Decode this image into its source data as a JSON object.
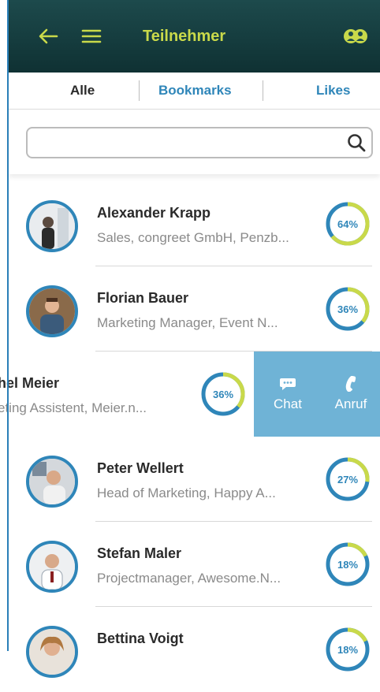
{
  "header": {
    "title": "Teilnehmer",
    "back_icon": "arrow-left-icon",
    "menu_icon": "hamburger-menu-icon",
    "people_icon": "people-icon",
    "accent_color": "#c9d94a"
  },
  "tabs": [
    {
      "label": "Alle",
      "active": true
    },
    {
      "label": "Bookmarks",
      "active": false
    },
    {
      "label": "Likes",
      "active": false
    }
  ],
  "search": {
    "placeholder": "",
    "value": "",
    "icon": "search-icon"
  },
  "participants": [
    {
      "name": "Alexander Krapp",
      "subtitle": "Sales, congreet GmbH, Penzb...",
      "match": "64%",
      "match_value": 0.64
    },
    {
      "name": "Florian Bauer",
      "subtitle": "Marketing Manager, Event N...",
      "match": "36%",
      "match_value": 0.36
    },
    {
      "name": "hel Meier",
      "subtitle": "eting Assistent, Meier.n...",
      "match": "36%",
      "match_value": 0.36,
      "swiped": true
    },
    {
      "name": "Peter Wellert",
      "subtitle": "Head of Marketing, Happy A...",
      "match": "27%",
      "match_value": 0.27
    },
    {
      "name": "Stefan Maler",
      "subtitle": "Projectmanager, Awesome.N...",
      "match": "18%",
      "match_value": 0.18
    },
    {
      "name": "Bettina Voigt",
      "subtitle": "",
      "match": "18%",
      "match_value": 0.18
    }
  ],
  "swipe_actions": {
    "chat_label": "Chat",
    "call_label": "Anruf",
    "chat_icon": "chat-bubble-icon",
    "call_icon": "phone-icon",
    "background": "#6fb3d6"
  },
  "colors": {
    "ring_fill": "#c9d94a",
    "ring_track": "#2f86b9",
    "link": "#2f86b9"
  }
}
